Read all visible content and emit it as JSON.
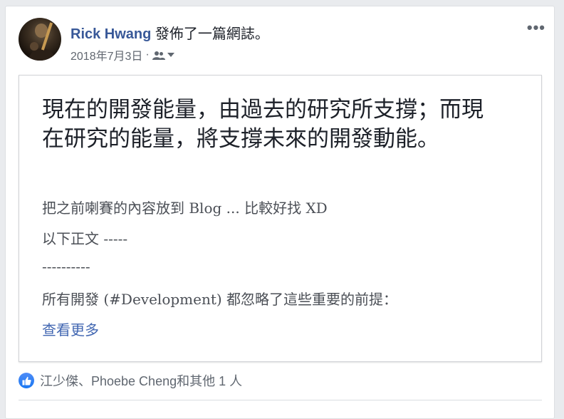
{
  "post": {
    "author": "Rick Hwang",
    "action_text": " 發佈了一篇網誌。",
    "date": "2018年7月3日",
    "separator": "·",
    "privacy_icon": "friends-icon",
    "more_label": "•••"
  },
  "note": {
    "title": "現在的開發能量，由過去的研究所支撐；而現在研究的能量，將支撐未來的開發動能。",
    "paragraphs": [
      "把之前喇賽的內容放到 Blog ... 比較好找 XD",
      "以下正文 -----",
      "----------",
      "所有開發 (#Development) 都忽略了這些重要的前提："
    ],
    "see_more": "查看更多"
  },
  "reactions": {
    "icon": "like-icon",
    "text": "江少傑、Phoebe Cheng和其他 1 人"
  },
  "colors": {
    "author": "#385898",
    "link": "#4267b2",
    "like": "#1877f2"
  }
}
